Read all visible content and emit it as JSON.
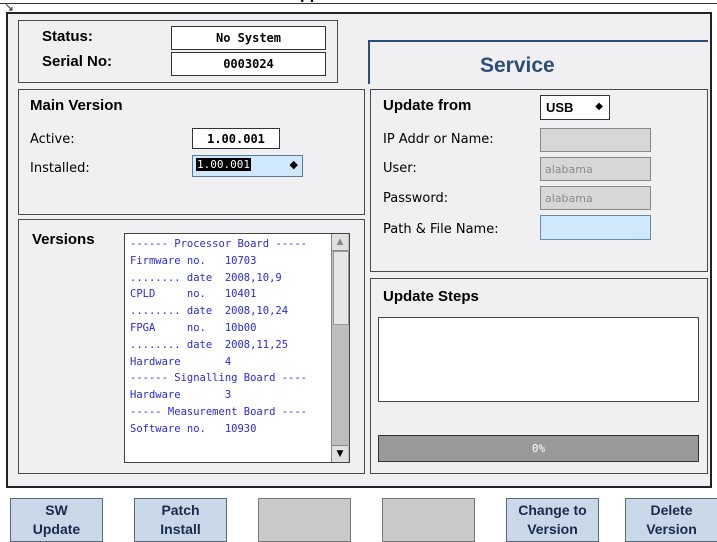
{
  "window": {
    "title_fragment": "pp"
  },
  "status_panel": {
    "status_label": "Status:",
    "status_value": "No System",
    "serial_label": "Serial No:",
    "serial_value": "0003024"
  },
  "service_tab": {
    "label": "Service"
  },
  "main_version": {
    "title": "Main Version",
    "active_label": "Active:",
    "active_value": "1.00.001",
    "installed_label": "Installed:",
    "installed_value": "1.00.001"
  },
  "versions": {
    "title": "Versions",
    "lines": [
      "------ Processor Board -----",
      "Firmware no.   10703",
      "........ date  2008,10,9",
      "CPLD     no.   10401",
      "........ date  2008,10,24",
      "FPGA     no.   10b00",
      "........ date  2008,11,25",
      "Hardware       4",
      "------ Signalling Board ----",
      "Hardware       3",
      "----- Measurement Board ----",
      "Software no.   10930"
    ]
  },
  "update_from": {
    "title": "Update from",
    "source_value": "USB",
    "ip_label": "IP Addr or Name:",
    "ip_value": "",
    "user_label": "User:",
    "user_value": "alabama",
    "password_label": "Password:",
    "password_value": "alabama",
    "path_label": "Path & File Name:",
    "path_value": ""
  },
  "update_steps": {
    "title": "Update Steps",
    "progress_text": "0%",
    "progress": 0
  },
  "toolbar": {
    "sw_update": [
      "SW",
      "Update"
    ],
    "patch_install": [
      "Patch",
      "Install"
    ],
    "change_version": [
      "Change to",
      "Version"
    ],
    "delete_version": [
      "Delete",
      "Version"
    ]
  },
  "colors": {
    "service_text": "#2c4f7a",
    "button_bg": "#c8d8e8",
    "list_text": "#2a2ad8",
    "path_field_bg": "#cfe8fb"
  }
}
